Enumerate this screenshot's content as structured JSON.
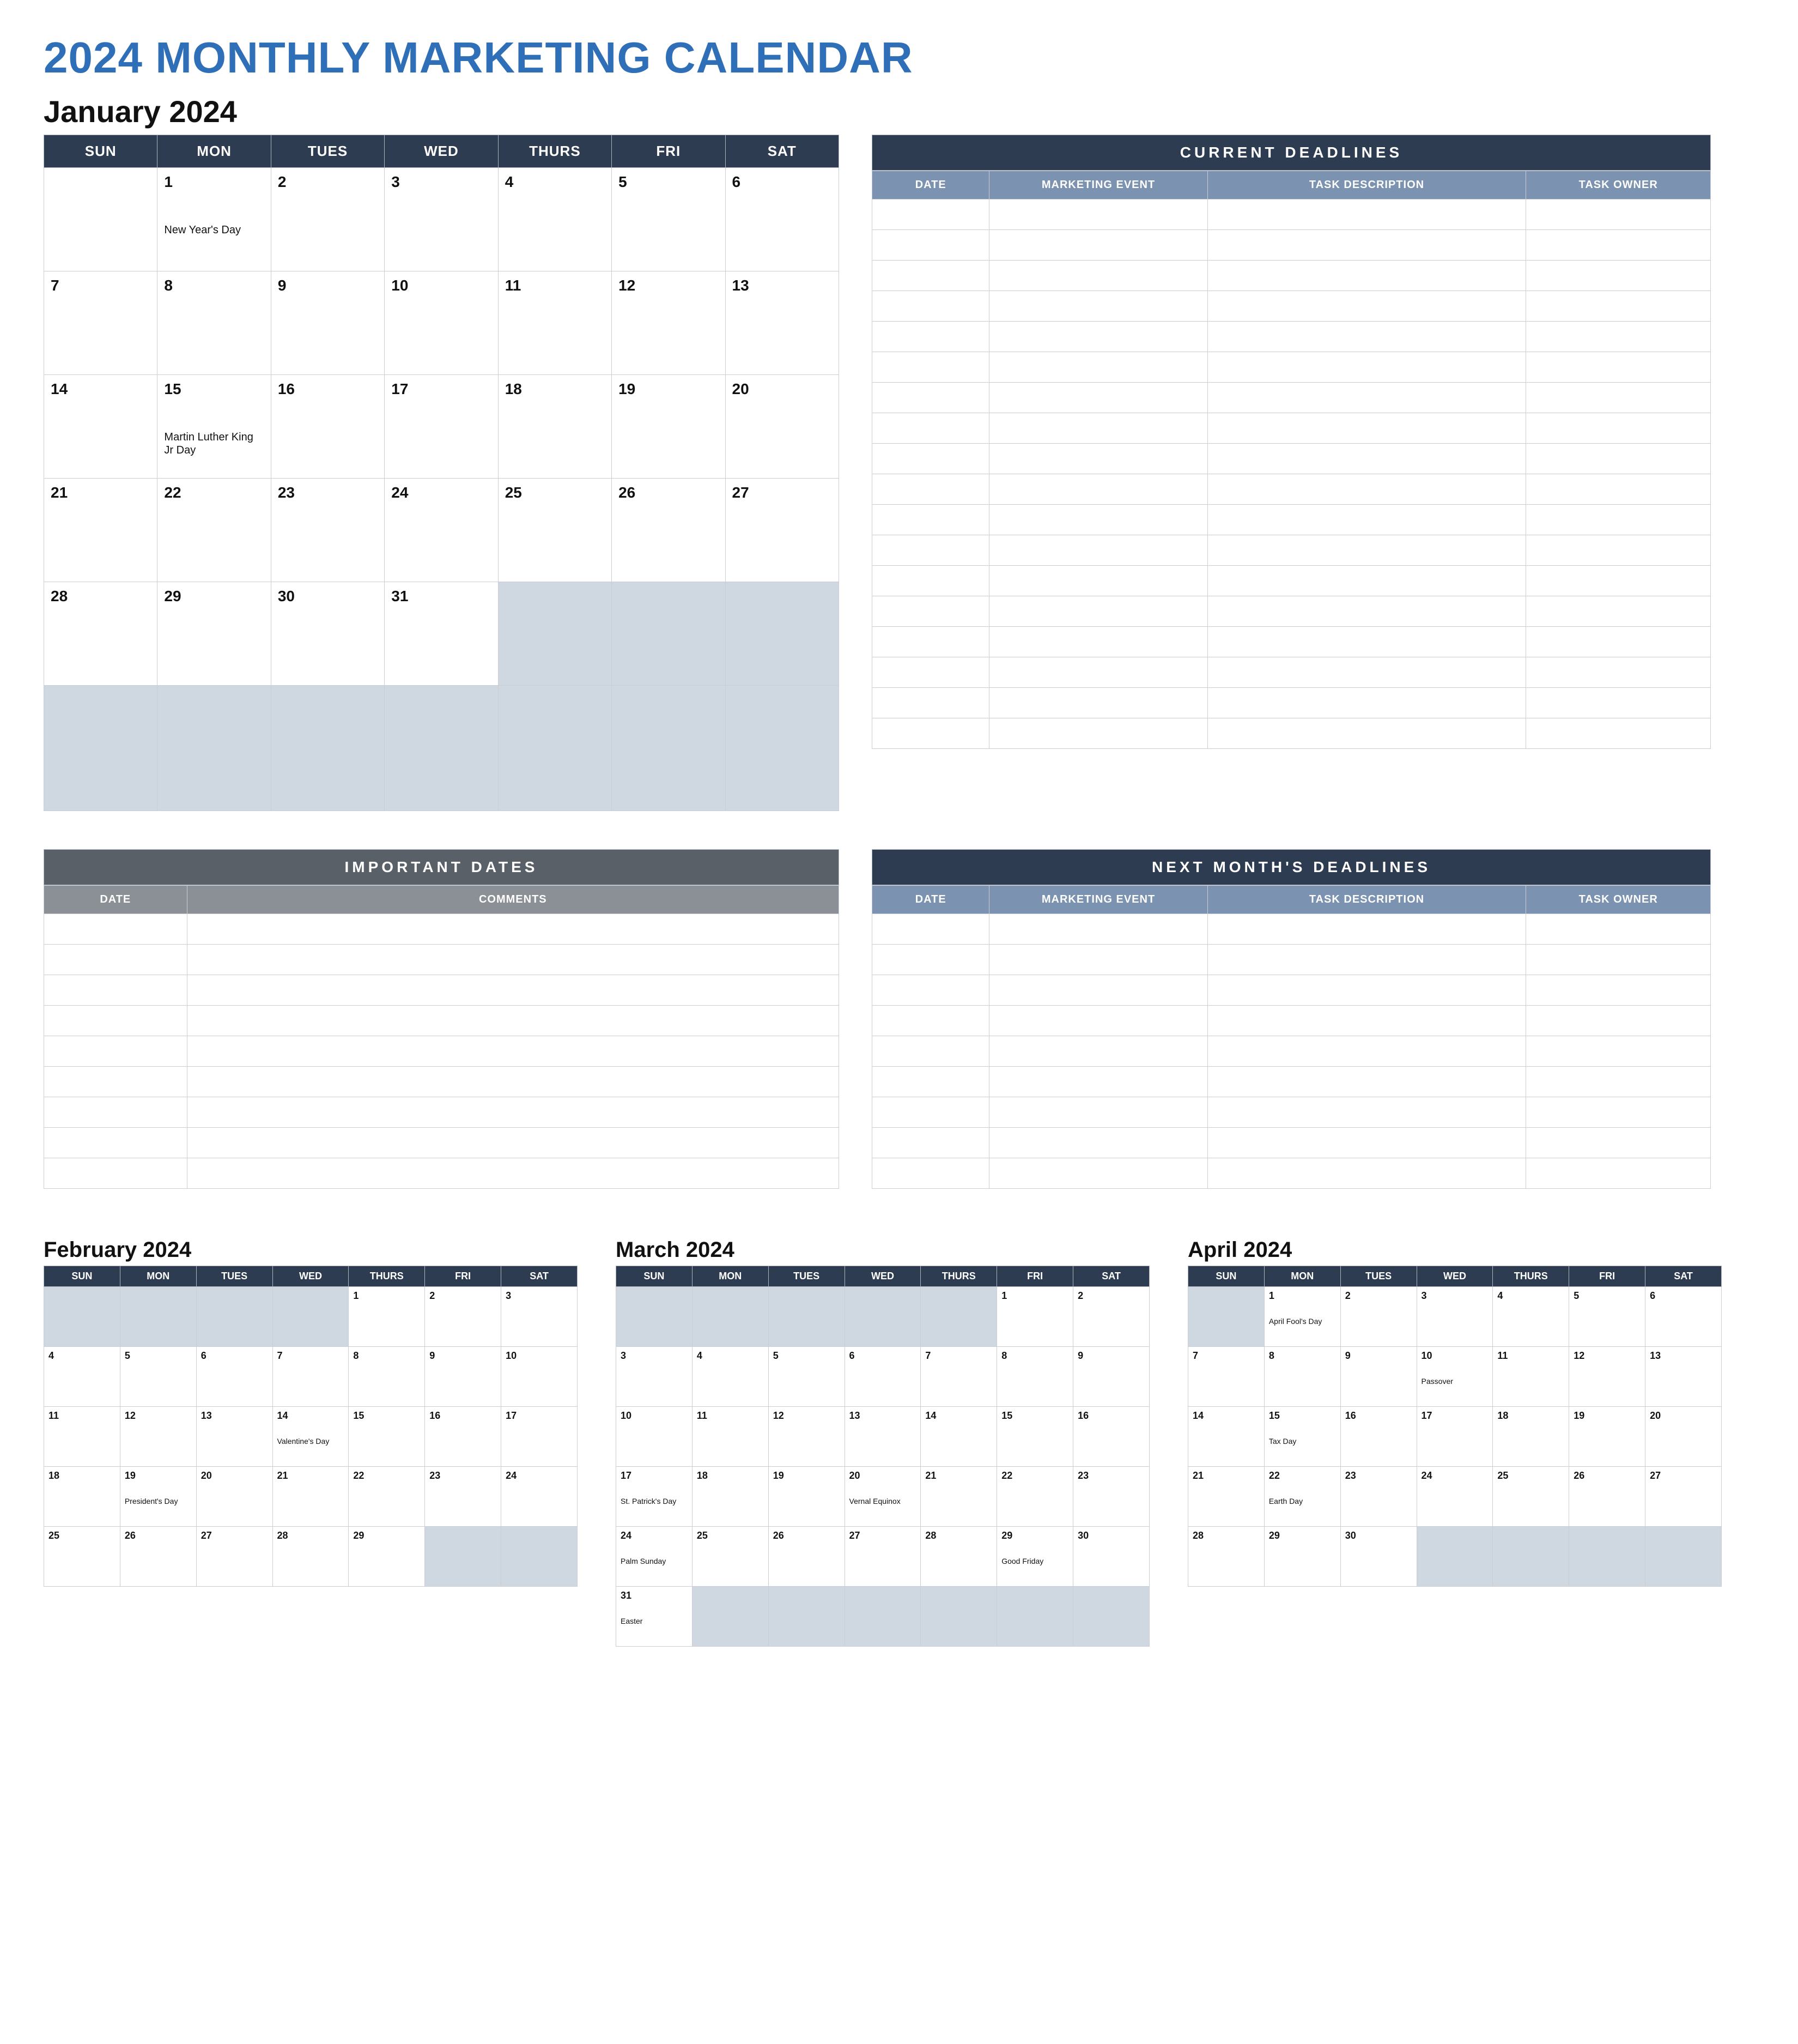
{
  "title": "2024 MONTHLY MARKETING CALENDAR",
  "main_month_title": "January 2024",
  "day_headers": [
    "SUN",
    "MON",
    "TUES",
    "WED",
    "THURS",
    "FRI",
    "SAT"
  ],
  "january": {
    "weeks": [
      [
        {
          "n": "",
          "blank": false
        },
        {
          "n": "1",
          "event": "New Year's Day"
        },
        {
          "n": "2"
        },
        {
          "n": "3"
        },
        {
          "n": "4"
        },
        {
          "n": "5"
        },
        {
          "n": "6"
        }
      ],
      [
        {
          "n": "7"
        },
        {
          "n": "8"
        },
        {
          "n": "9"
        },
        {
          "n": "10"
        },
        {
          "n": "11"
        },
        {
          "n": "12"
        },
        {
          "n": "13"
        }
      ],
      [
        {
          "n": "14"
        },
        {
          "n": "15",
          "event": "Martin Luther King Jr Day"
        },
        {
          "n": "16"
        },
        {
          "n": "17"
        },
        {
          "n": "18"
        },
        {
          "n": "19"
        },
        {
          "n": "20"
        }
      ],
      [
        {
          "n": "21"
        },
        {
          "n": "22"
        },
        {
          "n": "23"
        },
        {
          "n": "24"
        },
        {
          "n": "25"
        },
        {
          "n": "26"
        },
        {
          "n": "27"
        }
      ],
      [
        {
          "n": "28"
        },
        {
          "n": "29"
        },
        {
          "n": "30"
        },
        {
          "n": "31"
        },
        {
          "n": "",
          "blank": true
        },
        {
          "n": "",
          "blank": true
        },
        {
          "n": "",
          "blank": true
        }
      ],
      [
        {
          "n": "",
          "blank": true
        },
        {
          "n": "",
          "blank": true
        },
        {
          "n": "",
          "blank": true
        },
        {
          "n": "",
          "blank": true
        },
        {
          "n": "",
          "blank": true
        },
        {
          "n": "",
          "blank": true
        },
        {
          "n": "",
          "blank": true
        }
      ]
    ]
  },
  "current_deadlines": {
    "title": "CURRENT DEADLINES",
    "cols": [
      "DATE",
      "MARKETING EVENT",
      "TASK DESCRIPTION",
      "TASK OWNER"
    ],
    "col_widths": [
      "14%",
      "26%",
      "38%",
      "22%"
    ],
    "rows": 18
  },
  "important_dates": {
    "title": "IMPORTANT DATES",
    "cols": [
      "DATE",
      "COMMENTS"
    ],
    "col_widths": [
      "18%",
      "82%"
    ],
    "rows": 9
  },
  "next_deadlines": {
    "title": "NEXT MONTH'S DEADLINES",
    "cols": [
      "DATE",
      "MARKETING EVENT",
      "TASK DESCRIPTION",
      "TASK OWNER"
    ],
    "col_widths": [
      "14%",
      "26%",
      "38%",
      "22%"
    ],
    "rows": 9
  },
  "mini_months": [
    {
      "title": "February 2024",
      "weeks": [
        [
          {
            "n": "",
            "blank": true
          },
          {
            "n": "",
            "blank": true
          },
          {
            "n": "",
            "blank": true
          },
          {
            "n": "",
            "blank": true
          },
          {
            "n": "1"
          },
          {
            "n": "2"
          },
          {
            "n": "3"
          }
        ],
        [
          {
            "n": "4"
          },
          {
            "n": "5"
          },
          {
            "n": "6"
          },
          {
            "n": "7"
          },
          {
            "n": "8"
          },
          {
            "n": "9"
          },
          {
            "n": "10"
          }
        ],
        [
          {
            "n": "11"
          },
          {
            "n": "12"
          },
          {
            "n": "13"
          },
          {
            "n": "14",
            "event": "Valentine's Day"
          },
          {
            "n": "15"
          },
          {
            "n": "16"
          },
          {
            "n": "17"
          }
        ],
        [
          {
            "n": "18"
          },
          {
            "n": "19",
            "event": "President's Day"
          },
          {
            "n": "20"
          },
          {
            "n": "21"
          },
          {
            "n": "22"
          },
          {
            "n": "23"
          },
          {
            "n": "24"
          }
        ],
        [
          {
            "n": "25"
          },
          {
            "n": "26"
          },
          {
            "n": "27"
          },
          {
            "n": "28"
          },
          {
            "n": "29"
          },
          {
            "n": "",
            "blank": true
          },
          {
            "n": "",
            "blank": true
          }
        ]
      ]
    },
    {
      "title": "March 2024",
      "weeks": [
        [
          {
            "n": "",
            "blank": true
          },
          {
            "n": "",
            "blank": true
          },
          {
            "n": "",
            "blank": true
          },
          {
            "n": "",
            "blank": true
          },
          {
            "n": "",
            "blank": true
          },
          {
            "n": "1"
          },
          {
            "n": "2"
          }
        ],
        [
          {
            "n": "3"
          },
          {
            "n": "4"
          },
          {
            "n": "5"
          },
          {
            "n": "6"
          },
          {
            "n": "7"
          },
          {
            "n": "8"
          },
          {
            "n": "9"
          }
        ],
        [
          {
            "n": "10"
          },
          {
            "n": "11"
          },
          {
            "n": "12"
          },
          {
            "n": "13"
          },
          {
            "n": "14"
          },
          {
            "n": "15"
          },
          {
            "n": "16"
          }
        ],
        [
          {
            "n": "17",
            "event": "St. Patrick's Day"
          },
          {
            "n": "18"
          },
          {
            "n": "19"
          },
          {
            "n": "20",
            "event": "Vernal Equinox"
          },
          {
            "n": "21"
          },
          {
            "n": "22"
          },
          {
            "n": "23"
          }
        ],
        [
          {
            "n": "24",
            "event": "Palm Sunday"
          },
          {
            "n": "25"
          },
          {
            "n": "26"
          },
          {
            "n": "27"
          },
          {
            "n": "28"
          },
          {
            "n": "29",
            "event": "Good Friday"
          },
          {
            "n": "30"
          }
        ],
        [
          {
            "n": "31",
            "event": "Easter"
          },
          {
            "n": "",
            "blank": true
          },
          {
            "n": "",
            "blank": true
          },
          {
            "n": "",
            "blank": true
          },
          {
            "n": "",
            "blank": true
          },
          {
            "n": "",
            "blank": true
          },
          {
            "n": "",
            "blank": true
          }
        ]
      ]
    },
    {
      "title": "April 2024",
      "weeks": [
        [
          {
            "n": "",
            "blank": true
          },
          {
            "n": "1",
            "event": "April Fool's Day"
          },
          {
            "n": "2"
          },
          {
            "n": "3"
          },
          {
            "n": "4"
          },
          {
            "n": "5"
          },
          {
            "n": "6"
          }
        ],
        [
          {
            "n": "7"
          },
          {
            "n": "8"
          },
          {
            "n": "9"
          },
          {
            "n": "10",
            "event": "Passover"
          },
          {
            "n": "11"
          },
          {
            "n": "12"
          },
          {
            "n": "13"
          }
        ],
        [
          {
            "n": "14"
          },
          {
            "n": "15",
            "event": "Tax Day"
          },
          {
            "n": "16"
          },
          {
            "n": "17"
          },
          {
            "n": "18"
          },
          {
            "n": "19"
          },
          {
            "n": "20"
          }
        ],
        [
          {
            "n": "21"
          },
          {
            "n": "22",
            "event": "Earth Day"
          },
          {
            "n": "23"
          },
          {
            "n": "24"
          },
          {
            "n": "25"
          },
          {
            "n": "26"
          },
          {
            "n": "27"
          }
        ],
        [
          {
            "n": "28"
          },
          {
            "n": "29"
          },
          {
            "n": "30"
          },
          {
            "n": "",
            "blank": true
          },
          {
            "n": "",
            "blank": true
          },
          {
            "n": "",
            "blank": true
          },
          {
            "n": "",
            "blank": true
          }
        ]
      ]
    }
  ]
}
